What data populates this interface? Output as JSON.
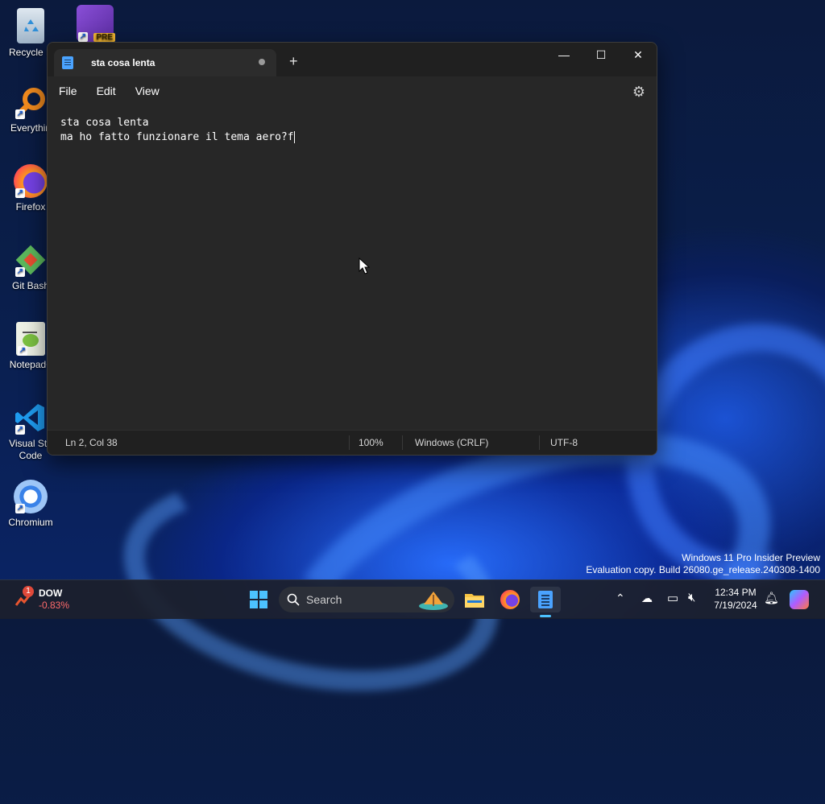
{
  "desktop": {
    "icons": [
      {
        "label": "Recycle B",
        "icon": "recycle-bin-icon"
      },
      {
        "label": "Everythin",
        "icon": "everything-search-icon"
      },
      {
        "label": "Firefox",
        "icon": "firefox-icon"
      },
      {
        "label": "Git Bash",
        "icon": "git-bash-icon"
      },
      {
        "label": "Notepad+",
        "icon": "notepad-plus-plus-icon"
      },
      {
        "label": "Visual Stu Code",
        "line1": "Visual Stu",
        "line2": "Code",
        "icon": "vscode-icon"
      },
      {
        "label": "Chromium",
        "icon": "chromium-icon"
      },
      {
        "label": "PRE",
        "icon": "visual-studio-preview-icon"
      }
    ],
    "watermark": {
      "line1": "Windows 11 Pro Insider Preview",
      "line2": "Evaluation copy. Build 26080.ge_release.240308-1400"
    }
  },
  "notepad": {
    "tab_title": "sta cosa lenta",
    "new_tab": "+",
    "menu": {
      "file": "File",
      "edit": "Edit",
      "view": "View"
    },
    "content": {
      "line1": "sta cosa lenta",
      "line2": "ma ho fatto funzionare il tema aero?f"
    },
    "status": {
      "position": "Ln 2, Col 38",
      "zoom": "100%",
      "line_ending": "Windows (CRLF)",
      "encoding": "UTF-8"
    },
    "controls": {
      "minimize": "—",
      "maximize": "☐",
      "close": "✕"
    }
  },
  "taskbar": {
    "widget": {
      "badge": "1",
      "ticker": "DOW",
      "change": "-0.83%"
    },
    "search_label": "Search",
    "clock": {
      "time": "12:34 PM",
      "date": "7/19/2024"
    },
    "colors": {
      "accent": "#4aa3ff",
      "negative": "#ff6b6b"
    }
  }
}
